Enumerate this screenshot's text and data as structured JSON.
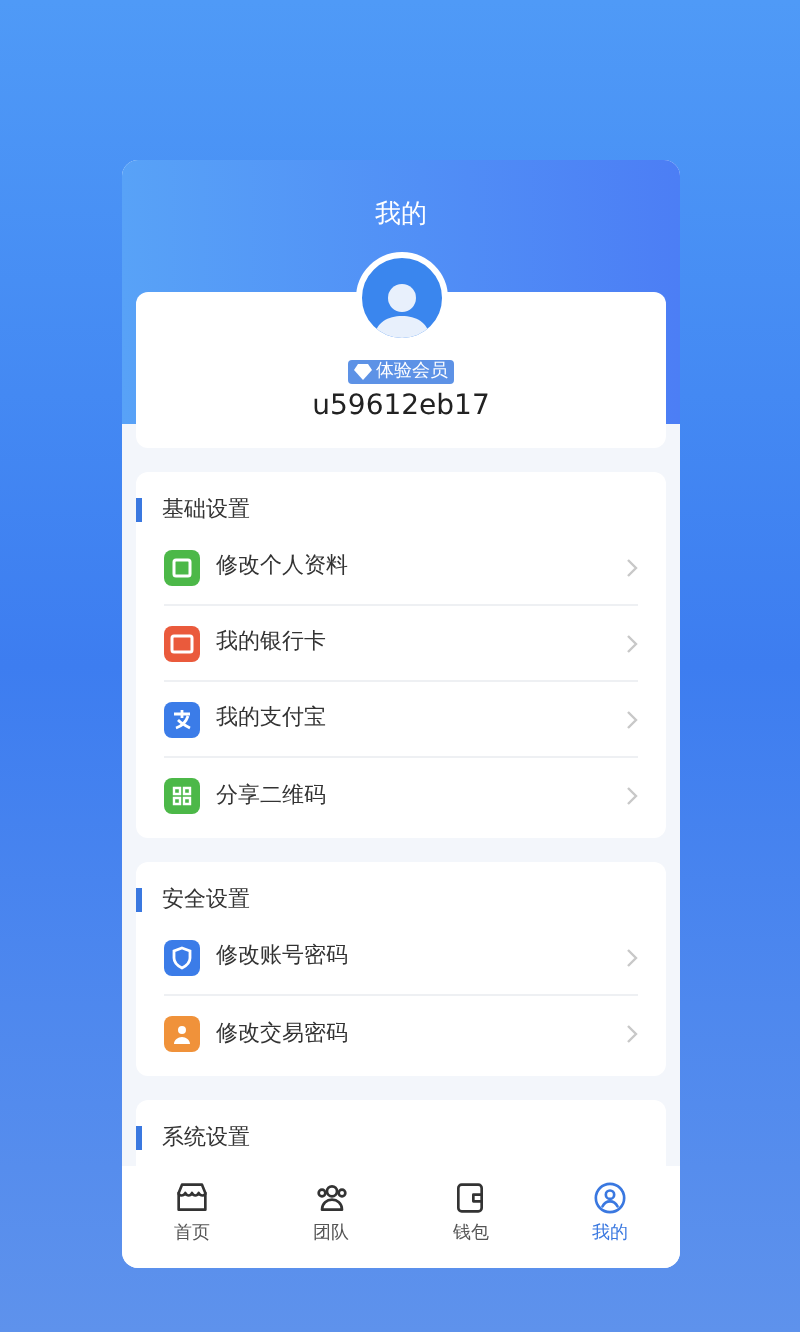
{
  "header": {
    "title": "我的"
  },
  "profile": {
    "badge": "体验会员",
    "username": "u59612eb17"
  },
  "sections": [
    {
      "title": "基础设置",
      "items": [
        {
          "label": "修改个人资料",
          "color": "#4cb848",
          "kind": "profile"
        },
        {
          "label": "我的银行卡",
          "color": "#ea5a3c",
          "kind": "card"
        },
        {
          "label": "我的支付宝",
          "color": "#3b7ce8",
          "kind": "alipay"
        },
        {
          "label": "分享二维码",
          "color": "#4cb848",
          "kind": "qr"
        }
      ]
    },
    {
      "title": "安全设置",
      "items": [
        {
          "label": "修改账号密码",
          "color": "#3b7ce8",
          "kind": "shield"
        },
        {
          "label": "修改交易密码",
          "color": "#f0923a",
          "kind": "user"
        }
      ]
    },
    {
      "title": "系统设置"
    }
  ],
  "tabs": [
    {
      "label": "首页",
      "kind": "shop",
      "selected": false
    },
    {
      "label": "团队",
      "kind": "team",
      "selected": false
    },
    {
      "label": "钱包",
      "kind": "wallet",
      "selected": false
    },
    {
      "label": "我的",
      "kind": "me",
      "selected": true
    }
  ]
}
